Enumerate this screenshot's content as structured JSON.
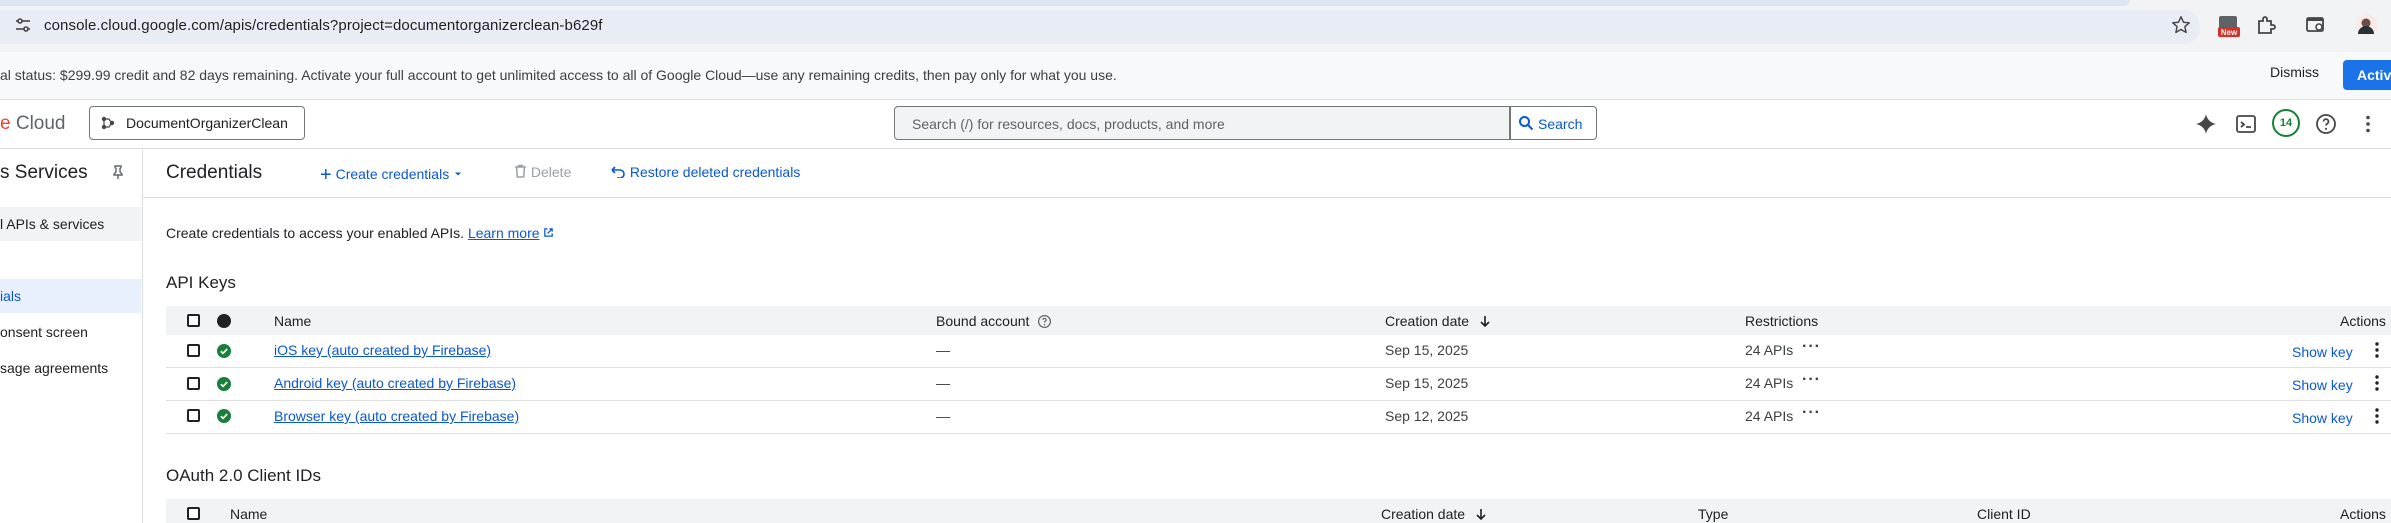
{
  "browser": {
    "url": "console.cloud.google.com/apis/credentials?project=documentorganizerclean-b629f",
    "new_badge": "New"
  },
  "banner": {
    "text": "al status: $299.99 credit and 82 days remaining. Activate your full account to get unlimited access to all of Google Cloud—use any remaining credits, then pay only for what you use.",
    "dismiss_label": "Dismiss",
    "activate_label": "Activ"
  },
  "header": {
    "logo_partial": "e",
    "logo_cloud": " Cloud",
    "project_name": "DocumentOrganizerClean",
    "search_placeholder": "Search (/) for resources, docs, products, and more",
    "search_button": "Search",
    "notification_count": "14"
  },
  "sidebar": {
    "title": "Services",
    "title_prefix": "s",
    "items": [
      {
        "label": "l APIs & services"
      },
      {
        "label": "ials"
      },
      {
        "label": "onsent screen"
      },
      {
        "label": "sage agreements"
      }
    ]
  },
  "main": {
    "title": "Credentials",
    "create_label": "Create credentials",
    "delete_label": "Delete",
    "restore_label": "Restore deleted credentials",
    "intro_text": "Create credentials to access your enabled APIs.",
    "learn_more": "Learn more"
  },
  "api_keys": {
    "title": "API Keys",
    "columns": {
      "name": "Name",
      "bound_account": "Bound account",
      "creation_date": "Creation date",
      "restrictions": "Restrictions",
      "actions": "Actions"
    },
    "rows": [
      {
        "name": "iOS key (auto created by Firebase)",
        "bound": "—",
        "date": "Sep 15, 2025",
        "restrictions": "24 APIs",
        "action": "Show key"
      },
      {
        "name": "Android key (auto created by Firebase)",
        "bound": "—",
        "date": "Sep 15, 2025",
        "restrictions": "24 APIs",
        "action": "Show key"
      },
      {
        "name": "Browser key (auto created by Firebase)",
        "bound": "—",
        "date": "Sep 12, 2025",
        "restrictions": "24 APIs",
        "action": "Show key"
      }
    ]
  },
  "oauth": {
    "title": "OAuth 2.0 Client IDs",
    "columns": {
      "name": "Name",
      "creation_date": "Creation date",
      "type": "Type",
      "client_id": "Client ID",
      "actions": "Actions"
    }
  },
  "colors": {
    "accent": "#0b57d0",
    "primary_button": "#1a73e8",
    "success": "#188038"
  },
  "icons": {
    "tune": "tune-icon",
    "star": "star-icon",
    "search": "search-icon",
    "pin": "pin-icon",
    "add": "add-icon",
    "trash": "trash-icon",
    "undo": "undo-icon",
    "external": "external-link-icon",
    "check": "check-circle-icon",
    "sort": "arrow-down-icon",
    "help": "help-icon"
  }
}
